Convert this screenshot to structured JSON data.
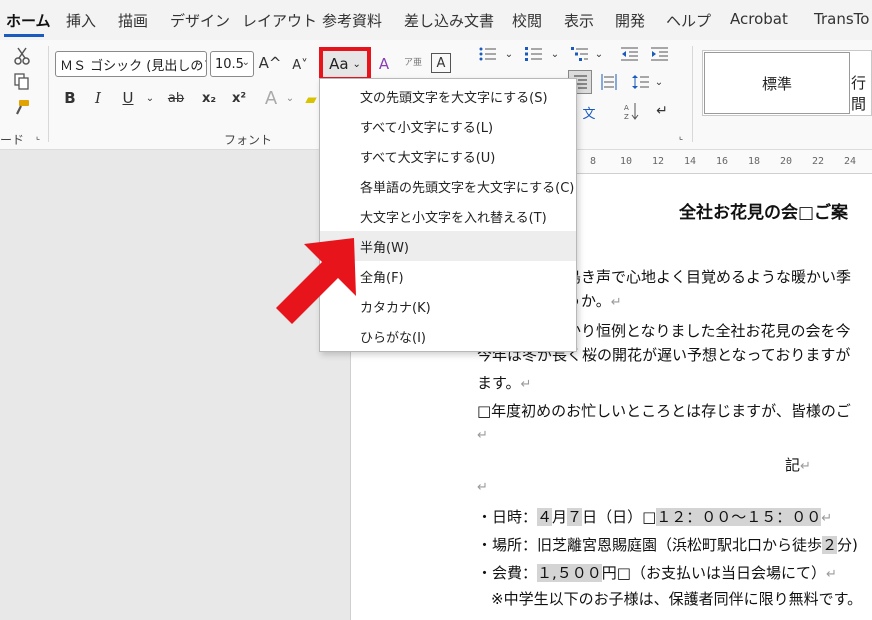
{
  "tabs": [
    "ホーム",
    "挿入",
    "描画",
    "デザイン",
    "レイアウト",
    "参考資料",
    "差し込み文書",
    "校閲",
    "表示",
    "開発",
    "ヘルプ",
    "Acrobat",
    "TransTo"
  ],
  "font": {
    "name": "ＭＳ ゴシック (見出しのフ",
    "size": "10.5",
    "grow": "A^",
    "shrink": "A˅",
    "case_button": "Aa",
    "clear_format": "A",
    "phonetic": "ア亜",
    "border_char": "A",
    "bold": "B",
    "italic": "I",
    "underline": "U",
    "strike": "ab",
    "sub": "x₂",
    "sup": "x²",
    "effects": "A",
    "group_label": "フォント"
  },
  "clipboard": {
    "group_label": "ード"
  },
  "styles": {
    "standard": "標準",
    "next": "行間"
  },
  "case_menu": {
    "items": [
      "文の先頭文字を大文字にする(S)",
      "すべて小文字にする(L)",
      "すべて大文字にする(U)",
      "各単語の先頭文字を大文字にする(C)",
      "大文字と小文字を入れ替える(T)",
      "半角(W)",
      "全角(F)",
      "カタカナ(K)",
      "ひらがな(I)"
    ],
    "hovered": "半角(W)"
  },
  "ruler": [
    "8",
    "10",
    "12",
    "14",
    "16",
    "18",
    "20",
    "22",
    "24"
  ],
  "document": {
    "title": "全社お花見の会□ご案",
    "lines": [
      "鳥き声で心地よく目覚めるような暖かい季",
      "うか。",
      "かり恒例となりました全社お花見の会を今",
      "今年は冬が長く桜の開花が遅い予想となっておりますが",
      "ます。",
      "□年度初めのお忙しいところとは存じますが、皆様のご",
      "記"
    ],
    "date_prefix": "・日時：",
    "date_month": "４",
    "date_mid": "月",
    "date_day": "７",
    "date_rest": "日（日）□",
    "date_time": "１２：００～１５：００",
    "place": "・場所：旧芝離宮恩賜庭園（浜松町駅北口から徒歩",
    "place_min": "２",
    "place_end": "分)",
    "fee_prefix": "・会費：",
    "fee_amount": "１,５００",
    "fee_rest": "円□（お支払いは当日会場にて）",
    "note": "※中学生以下のお子様は、保護者同伴に限り無料です。",
    "return_mark": "↵"
  }
}
